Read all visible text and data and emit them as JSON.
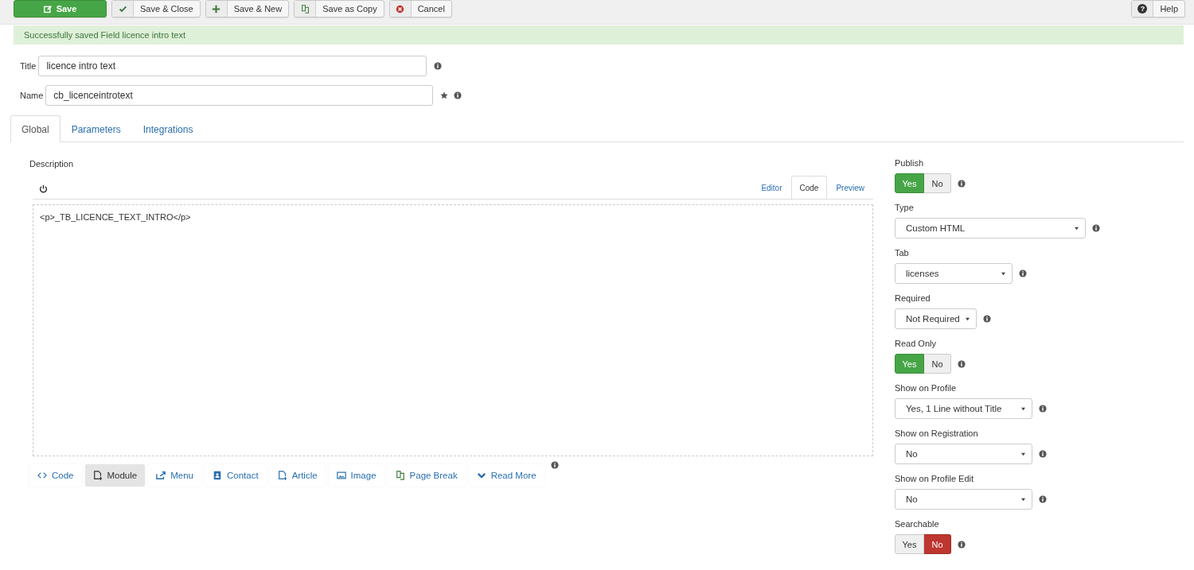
{
  "toolbar": {
    "buttons": [
      {
        "label": "Save",
        "kind": "save",
        "primary": true
      },
      {
        "label": "Save & Close",
        "kind": "check",
        "primary": false
      },
      {
        "label": "Save & New",
        "kind": "plus",
        "primary": false
      },
      {
        "label": "Save as Copy",
        "kind": "copy",
        "primary": false
      },
      {
        "label": "Cancel",
        "kind": "cancel",
        "primary": false
      }
    ],
    "help": {
      "icon": "?",
      "label": "Help"
    }
  },
  "alert": "Successfully saved Field licence intro text",
  "title_field": {
    "label": "Title",
    "value": "licence intro text"
  },
  "name_field": {
    "label": "Name",
    "value": "cb_licenceintrotext",
    "required": true
  },
  "tabs": [
    {
      "label": "Global",
      "selected": true
    },
    {
      "label": "Parameters",
      "selected": false
    },
    {
      "label": "Integrations",
      "selected": false
    }
  ],
  "description": {
    "label": "Description",
    "editor_tabs": [
      {
        "label": "Editor",
        "selected": false
      },
      {
        "label": "Code",
        "selected": true
      },
      {
        "label": "Preview",
        "selected": false
      }
    ],
    "content": "<p>_TB_LICENCE_TEXT_INTRO</p>",
    "buttons": [
      {
        "label": "Code",
        "kind": "code",
        "selected": false
      },
      {
        "label": "Module",
        "kind": "file-plus",
        "selected": true
      },
      {
        "label": "Menu",
        "kind": "share",
        "selected": false
      },
      {
        "label": "Contact",
        "kind": "contact",
        "selected": false
      },
      {
        "label": "Article",
        "kind": "file-plus",
        "selected": false
      },
      {
        "label": "Image",
        "kind": "image",
        "selected": false
      },
      {
        "label": "Page Break",
        "kind": "copy",
        "selected": false
      },
      {
        "label": "Read More",
        "kind": "chevron",
        "selected": false
      }
    ]
  },
  "settings": [
    {
      "label": "Publish",
      "kind": "toggle",
      "options": [
        {
          "label": "Yes",
          "kind": "positive",
          "selected": true
        },
        {
          "label": "No",
          "kind": "negative",
          "selected": false
        }
      ]
    },
    {
      "label": "Type",
      "kind": "select",
      "value": "Custom HTML"
    },
    {
      "label": "Tab",
      "kind": "select",
      "value": "licenses"
    },
    {
      "label": "Required",
      "kind": "select",
      "value": "Not Required"
    },
    {
      "label": "Read Only",
      "kind": "toggle",
      "options": [
        {
          "label": "Yes",
          "kind": "positive",
          "selected": true
        },
        {
          "label": "No",
          "kind": "negative",
          "selected": false
        }
      ]
    },
    {
      "label": "Show on Profile",
      "kind": "select",
      "value": "Yes, 1 Line without Title"
    },
    {
      "label": "Show on Registration",
      "kind": "select",
      "value": "No"
    },
    {
      "label": "Show on Profile Edit",
      "kind": "select",
      "value": "No"
    },
    {
      "label": "Searchable",
      "kind": "toggle",
      "options": [
        {
          "label": "Yes",
          "kind": "positive",
          "selected": false
        },
        {
          "label": "No",
          "kind": "negative",
          "selected": true
        }
      ]
    }
  ]
}
